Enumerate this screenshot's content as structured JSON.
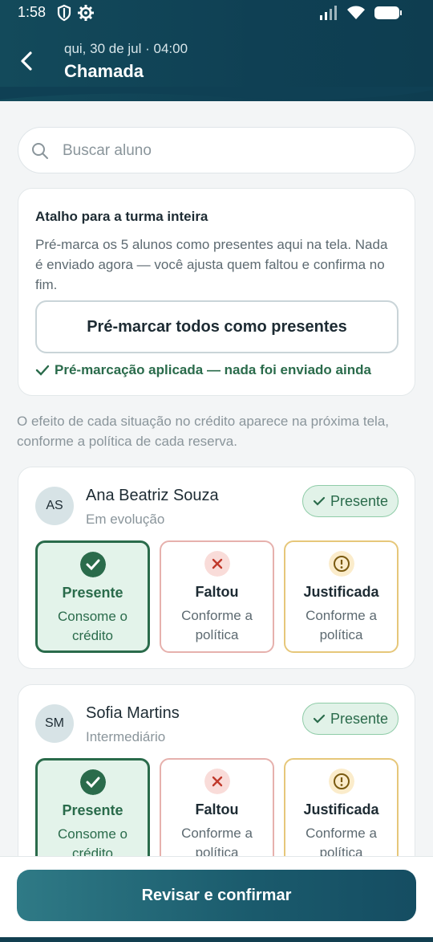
{
  "status_bar": {
    "time": "1:58"
  },
  "header": {
    "subtitle": "qui, 30 de jul · 04:00",
    "title": "Chamada"
  },
  "search": {
    "placeholder": "Buscar aluno"
  },
  "shortcut": {
    "title": "Atalho para a turma inteira",
    "description": "Pré-marca os 5 alunos como presentes aqui na tela. Nada é enviado agora — você ajusta quem faltou e confirma no fim.",
    "button_label": "Pré-marcar todos como presentes",
    "status_text": "Pré-marcação aplicada — nada foi enviado ainda"
  },
  "info_text": "O efeito de cada situação no crédito aparece na próxima tela, conforme a política de cada reserva.",
  "students": [
    {
      "initials": "AS",
      "name": "Ana Beatriz Souza",
      "level": "Em evolução",
      "badge": "Presente",
      "options": {
        "present": {
          "title": "Presente",
          "desc": "Consome o crédito"
        },
        "absent": {
          "title": "Faltou",
          "desc": "Conforme a política"
        },
        "justified": {
          "title": "Justificada",
          "desc": "Conforme a política"
        }
      }
    },
    {
      "initials": "SM",
      "name": "Sofia Martins",
      "level": "Intermediário",
      "badge": "Presente",
      "options": {
        "present": {
          "title": "Presente",
          "desc": "Consome o crédito"
        },
        "absent": {
          "title": "Faltou",
          "desc": "Conforme a política"
        },
        "justified": {
          "title": "Justificada",
          "desc": "Conforme a política"
        }
      }
    }
  ],
  "footer": {
    "confirm_label": "Revisar e confirmar"
  },
  "colors": {
    "primary": "#134a5b",
    "present": "#2a6b4b",
    "absent": "#c0392b",
    "justified": "#b7860b"
  }
}
